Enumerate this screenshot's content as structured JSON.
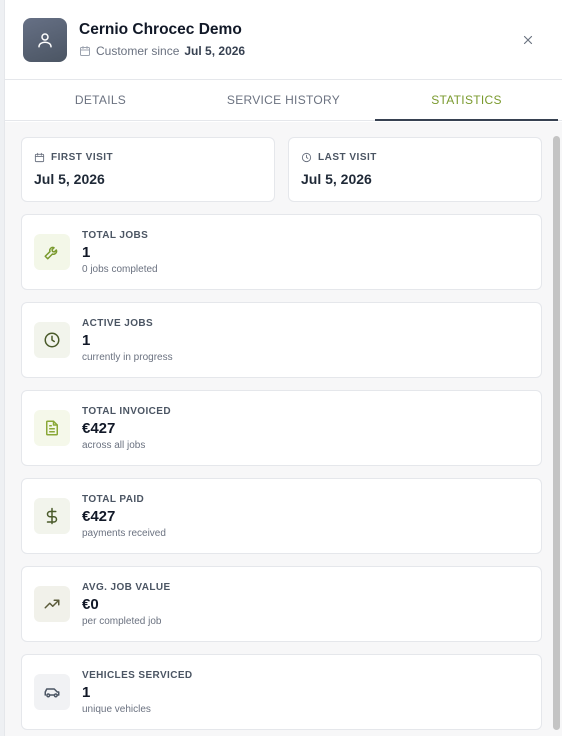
{
  "customer": {
    "name": "Cernio Chrocec Demo",
    "since_label": "Customer since",
    "since_date": "Jul 5, 2026"
  },
  "tabs": [
    {
      "label": "DETAILS",
      "active": false
    },
    {
      "label": "SERVICE HISTORY",
      "active": false
    },
    {
      "label": "STATISTICS",
      "active": true
    }
  ],
  "visits": {
    "first": {
      "label": "FIRST VISIT",
      "value": "Jul 5, 2026",
      "icon": "calendar-icon"
    },
    "last": {
      "label": "LAST VISIT",
      "value": "Jul 5, 2026",
      "icon": "clock-icon"
    }
  },
  "stats": [
    {
      "label": "TOTAL JOBS",
      "value": "1",
      "note": "0 jobs completed",
      "icon": "wrench-icon",
      "color": "#7a9a2e",
      "bg": "#f3f7e8"
    },
    {
      "label": "ACTIVE JOBS",
      "value": "1",
      "note": "currently in progress",
      "icon": "clock-icon",
      "color": "#4a5a2a",
      "bg": "#f2f4ec"
    },
    {
      "label": "TOTAL INVOICED",
      "value": "€427",
      "note": "across all jobs",
      "icon": "document-icon",
      "color": "#8aa838",
      "bg": "#f5f8ea"
    },
    {
      "label": "TOTAL PAID",
      "value": "€427",
      "note": "payments received",
      "icon": "dollar-icon",
      "color": "#4a5a2a",
      "bg": "#f2f4ec"
    },
    {
      "label": "AVG. JOB VALUE",
      "value": "€0",
      "note": "per completed job",
      "icon": "trending-up-icon",
      "color": "#5b5b3a",
      "bg": "#f1f1ea"
    },
    {
      "label": "VEHICLES SERVICED",
      "value": "1",
      "note": "unique vehicles",
      "icon": "car-icon",
      "color": "#4b5563",
      "bg": "#f1f2f4"
    }
  ],
  "colors": {
    "accent": "#7a9a2e",
    "tab_underline": "#374151"
  }
}
